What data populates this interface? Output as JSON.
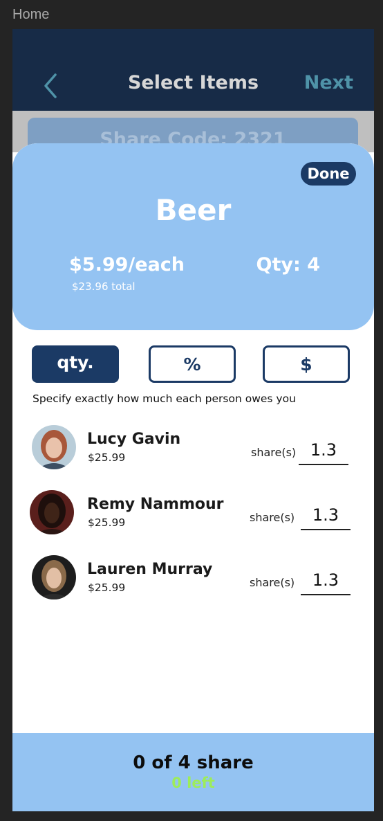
{
  "frame": {
    "label": "Home"
  },
  "nav": {
    "title": "Select Items",
    "next_label": "Next"
  },
  "share": {
    "code_text": "Share Code: 2321"
  },
  "item": {
    "done_label": "Done",
    "name": "Beer",
    "price_each": "$5.99/each",
    "price_total": "$23.96 total",
    "qty": "Qty: 4"
  },
  "tabs": [
    {
      "label": "qty.",
      "active": true
    },
    {
      "label": "%",
      "active": false
    },
    {
      "label": "$",
      "active": false
    }
  ],
  "hint": "Specify exactly how much each person owes you",
  "people": [
    {
      "name": "Lucy Gavin",
      "amount": "$25.99",
      "share_label": "share(s)",
      "share_value": "1.3"
    },
    {
      "name": "Remy Nammour",
      "amount": "$25.99",
      "share_label": "share(s)",
      "share_value": "1.3"
    },
    {
      "name": "Lauren Murray",
      "amount": "$25.99",
      "share_label": "share(s)",
      "share_value": "1.3"
    }
  ],
  "footer": {
    "count": "0 of 4 share",
    "left": "0 left"
  },
  "colors": {
    "nav_bg": "#172b47",
    "accent_light": "#94c3f2",
    "accent_dark": "#1b3a65",
    "next": "#4f93a8",
    "left_green": "#9dec5a"
  }
}
